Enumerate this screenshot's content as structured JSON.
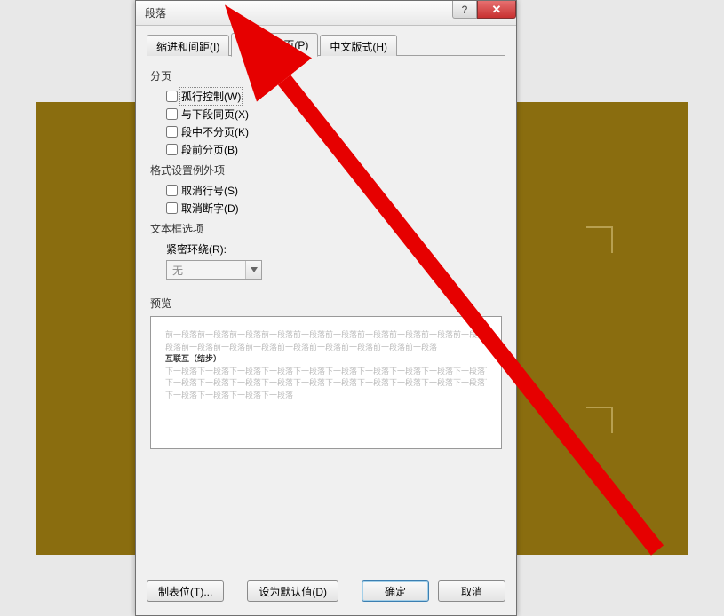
{
  "dialog": {
    "title": "段落",
    "help_symbol": "?",
    "close_symbol": "✕"
  },
  "tabs": {
    "indent": "缩进和间距(I)",
    "pagebreak": "换行和分页(P)",
    "chinese": "中文版式(H)"
  },
  "groups": {
    "pagination": {
      "label": "分页",
      "widow": "孤行控制(W)",
      "keep_next": "与下段同页(X)",
      "keep_lines": "段中不分页(K)",
      "page_break": "段前分页(B)"
    },
    "formatting": {
      "label": "格式设置例外项",
      "suppress_line": "取消行号(S)",
      "suppress_hyphen": "取消断字(D)"
    },
    "textbox": {
      "label": "文本框选项",
      "tight_wrap_label": "紧密环绕(R):",
      "tight_wrap_value": "无"
    },
    "preview": {
      "label": "预览",
      "sample_prev": "前一段落前一段落前一段落前一段落前一段落前一段落前一段落前一段落前一段落前一段落前一段落前一",
      "sample_prev2": "段落前一段落前一段落前一段落前一段落前一段落前一段落前一段落前一段落",
      "sample_main": "互联互（结步）",
      "sample_next": "下一段落下一段落下一段落下一段落下一段落下一段落下一段落下一段落下一段落下一段落下一段落下一段落",
      "sample_next2": "下一段落下一段落下一段落下一段落下一段落下一段落下一段落下一段落下一段落下一段落下一段落下一段落",
      "sample_next3": "下一段落下一段落下一段落下一段落"
    }
  },
  "buttons": {
    "tabs": "制表位(T)...",
    "defaults": "设为默认值(D)",
    "ok": "确定",
    "cancel": "取消"
  }
}
